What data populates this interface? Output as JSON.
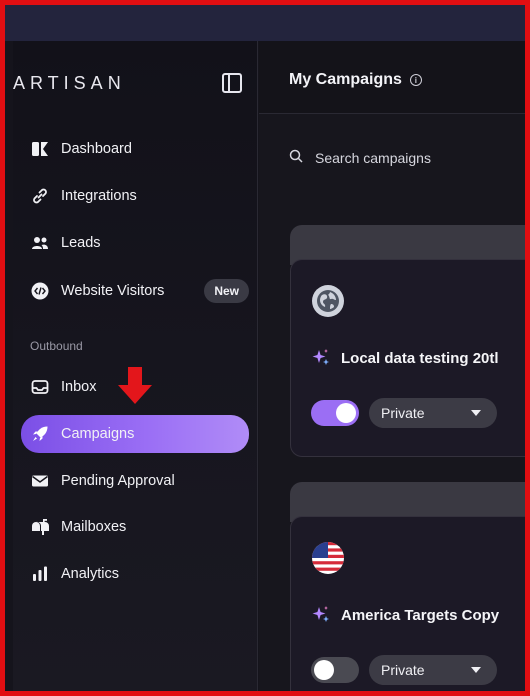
{
  "sidebar": {
    "logo": "ARTISAN",
    "section_label": "Outbound",
    "items": [
      {
        "label": "Dashboard"
      },
      {
        "label": "Integrations"
      },
      {
        "label": "Leads"
      },
      {
        "label": "Website Visitors",
        "badge": "New"
      },
      {
        "label": "Inbox"
      },
      {
        "label": "Campaigns",
        "active": true
      },
      {
        "label": "Pending Approval"
      },
      {
        "label": "Mailboxes"
      },
      {
        "label": "Analytics"
      }
    ]
  },
  "main": {
    "title": "My Campaigns",
    "search_placeholder": "Search campaigns",
    "cards": [
      {
        "name": "Local data testing 20tl",
        "enabled": true,
        "visibility": "Private",
        "avatar": "globe-icon"
      },
      {
        "name": "America Targets Copy",
        "enabled": false,
        "visibility": "Private",
        "avatar": "us-flag-icon"
      }
    ]
  },
  "colors": {
    "accent": "#9b6ef4",
    "highlight_border": "#e10e12",
    "arrow": "#e3161b"
  }
}
